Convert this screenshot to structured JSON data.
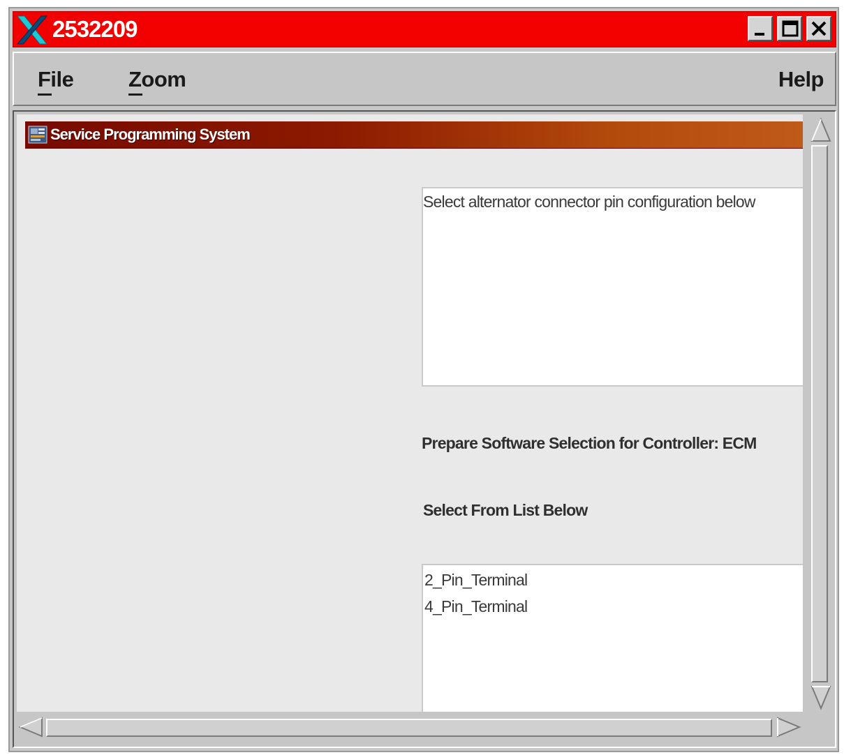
{
  "window": {
    "title": "2532209"
  },
  "menubar": {
    "file_label": "File",
    "zoom_label": "Zoom",
    "help_label": "Help"
  },
  "app": {
    "header_title": "Service Programming System",
    "message_text": "Select alternator connector pin configuration below",
    "prepare_label": "Prepare Software Selection for Controller: ECM",
    "select_label": "Select From List Below",
    "options": [
      "2_Pin_Terminal",
      "4_Pin_Terminal"
    ]
  },
  "colors": {
    "titlebar": "#f20000",
    "header_dark": "#770a00",
    "header_light": "#c05a18"
  }
}
